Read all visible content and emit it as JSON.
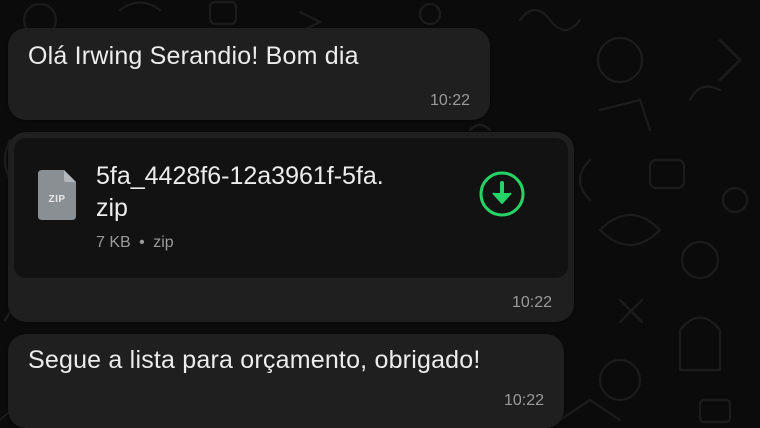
{
  "messages": [
    {
      "text": "Olá Irwing Serandio! Bom dia",
      "time": "10:22"
    },
    {
      "file": {
        "name_line1": "5fa_4428f6-12a3961f-5fa.",
        "name_line2": "zip",
        "ext_label": "ZIP",
        "size": "7 KB",
        "separator": "•",
        "type": "zip",
        "icon": "zip-file-icon",
        "action_icon": "download-icon"
      },
      "time": "10:22"
    },
    {
      "text": "Segue a lista para orçamento, obrigado!",
      "time": "10:22"
    }
  ],
  "colors": {
    "background": "#0b0b0b",
    "bubble": "#1f1f1f",
    "file_card": "#121212",
    "accent_green": "#25d366",
    "text": "#ececec",
    "meta_text": "#9a9a9a"
  }
}
